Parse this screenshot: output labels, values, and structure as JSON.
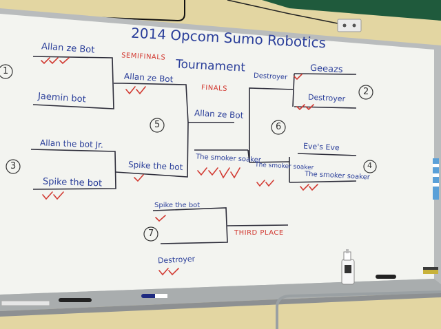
{
  "board": {
    "title_line1": "2014 Opcom Sumo Robotics",
    "title_line2": "Tournament",
    "labels": {
      "semifinals": "SEMIFINALS",
      "finals": "FINALS",
      "third_place": "THIRD PLACE"
    },
    "match_numbers": [
      "1",
      "2",
      "3",
      "4",
      "5",
      "6",
      "7"
    ],
    "entrants": [
      "Allan ze Bot",
      "Jaemin bot",
      "Allan the bot Jr.",
      "Spike the bot",
      "Geeazs",
      "Destroyer",
      "Eve's Eve",
      "The smoker soaker"
    ],
    "semifinal_winners": [
      "Allan ze Bot",
      "Spike the bot",
      "Destroyer",
      "The smoker soaker"
    ],
    "finalists": [
      "Allan ze Bot",
      "The smoker soaker"
    ],
    "third_place_match": [
      "Spike the bot",
      "Destroyer"
    ]
  },
  "colors": {
    "wall": "#e6d9a8",
    "whiteboard": "#f3f4f0",
    "marker_blue": "#2b3f9a",
    "marker_red": "#d23a32"
  }
}
